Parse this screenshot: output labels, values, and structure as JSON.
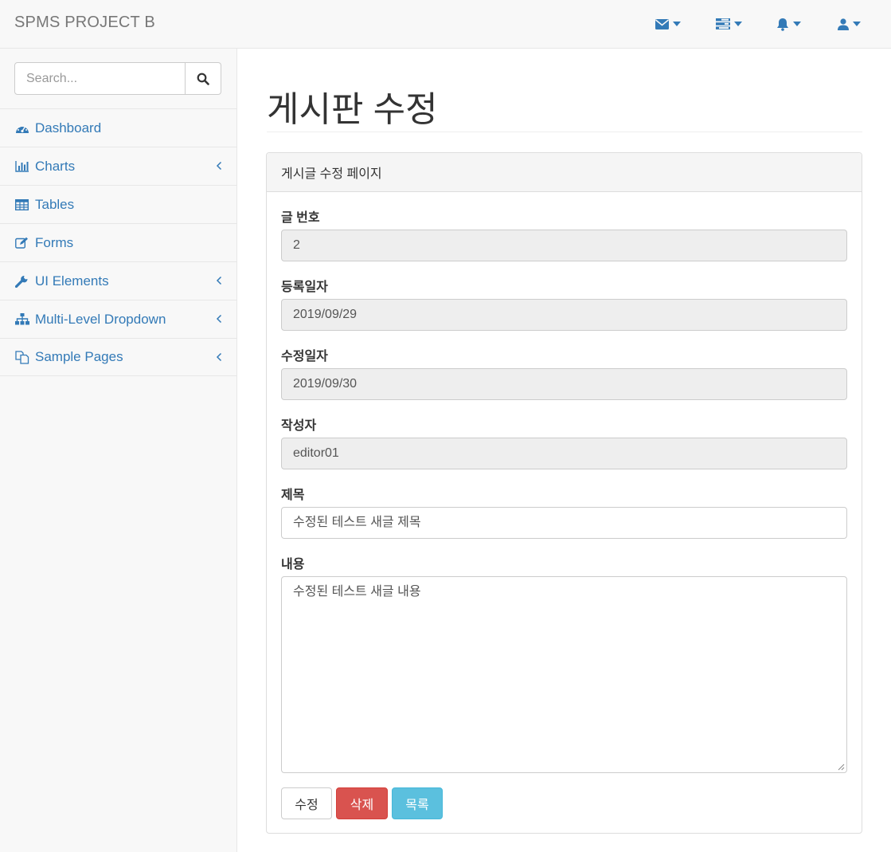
{
  "navbar": {
    "brand": "SPMS PROJECT B",
    "menus": [
      {
        "icon": "envelope-icon"
      },
      {
        "icon": "tasks-icon"
      },
      {
        "icon": "bell-icon"
      },
      {
        "icon": "user-icon"
      }
    ]
  },
  "sidebar": {
    "search_placeholder": "Search...",
    "items": [
      {
        "label": "Dashboard",
        "icon": "dashboard-icon",
        "has_submenu": false
      },
      {
        "label": "Charts",
        "icon": "bar-chart-icon",
        "has_submenu": true
      },
      {
        "label": "Tables",
        "icon": "table-icon",
        "has_submenu": false
      },
      {
        "label": "Forms",
        "icon": "edit-icon",
        "has_submenu": false
      },
      {
        "label": "UI Elements",
        "icon": "wrench-icon",
        "has_submenu": true
      },
      {
        "label": "Multi-Level Dropdown",
        "icon": "sitemap-icon",
        "has_submenu": true
      },
      {
        "label": "Sample Pages",
        "icon": "files-icon",
        "has_submenu": true
      }
    ]
  },
  "main": {
    "page_title": "게시판 수정",
    "panel_heading": "게시글 수정 페이지",
    "fields": {
      "post_no": {
        "label": "글 번호",
        "value": "2"
      },
      "reg_date": {
        "label": "등록일자",
        "value": "2019/09/29"
      },
      "mod_date": {
        "label": "수정일자",
        "value": "2019/09/30"
      },
      "writer": {
        "label": "작성자",
        "value": "editor01"
      },
      "title": {
        "label": "제목",
        "value": "수정된 테스트 새글 제목"
      },
      "content": {
        "label": "내용",
        "value": "수정된 테스트 새글 내용"
      }
    },
    "buttons": {
      "modify": "수정",
      "delete": "삭제",
      "list": "목록"
    }
  },
  "colors": {
    "link": "#337ab7",
    "danger": "#d9534f",
    "info": "#5bc0de"
  }
}
